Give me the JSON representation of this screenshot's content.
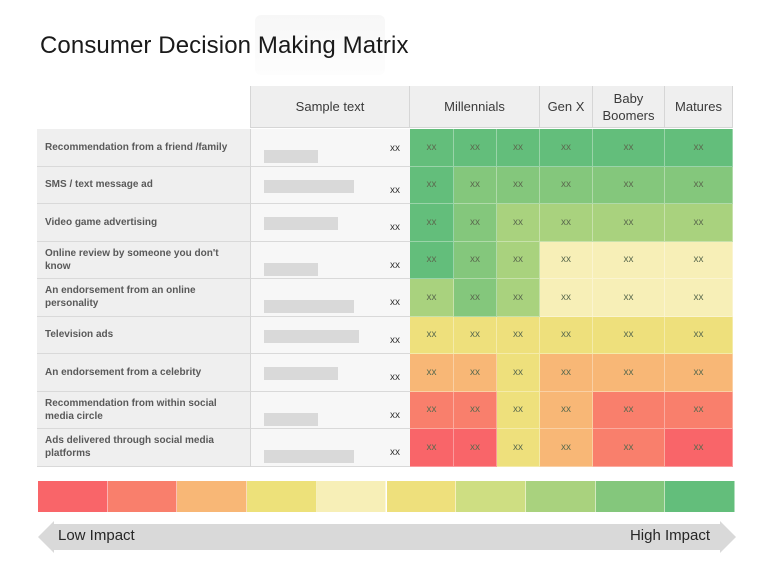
{
  "title": "Consumer Decision Making Matrix",
  "header": {
    "sample": "Sample text",
    "millennials": "Millennials",
    "genx": "Gen X",
    "baby_boomers": "Baby Boomers",
    "matures": "Matures"
  },
  "scale_colors": {
    "1": "#F96569",
    "2": "#F97F6C",
    "3": "#F8B776",
    "4": "#EDE17A",
    "5": "#F7EFB7",
    "6": "#EEE07C",
    "7": "#CEDE82",
    "8": "#A9D27E",
    "9": "#84C77C",
    "10": "#63BE7B"
  },
  "rows": [
    {
      "label": "Recommendation from a friend /family",
      "sample_value": "xx",
      "sample_fill": 0.6,
      "cell_text": "xx",
      "levels": [
        10,
        10,
        10,
        10,
        10,
        10
      ]
    },
    {
      "label": "SMS / text message ad",
      "sample_value": "xx",
      "sample_fill": 1.0,
      "cell_text": "xx",
      "levels": [
        10,
        9,
        9,
        9,
        9,
        9
      ]
    },
    {
      "label": "Video game advertising",
      "sample_value": "xx",
      "sample_fill": 0.82,
      "cell_text": "xx",
      "levels": [
        10,
        9,
        8,
        8,
        8,
        8
      ]
    },
    {
      "label": "Online review by someone you don't know",
      "sample_value": "xx",
      "sample_fill": 0.6,
      "cell_text": "xx",
      "levels": [
        10,
        9,
        8,
        5,
        5,
        5
      ]
    },
    {
      "label": "An endorsement from an online personality",
      "sample_value": "xx",
      "sample_fill": 1.0,
      "cell_text": "xx",
      "levels": [
        8,
        9,
        8,
        5,
        5,
        5
      ]
    },
    {
      "label": "Television ads",
      "sample_value": "xx",
      "sample_fill": 1.05,
      "cell_text": "xx",
      "levels": [
        6,
        6,
        6,
        6,
        6,
        6
      ]
    },
    {
      "label": "An endorsement from a celebrity",
      "sample_value": "xx",
      "sample_fill": 0.82,
      "cell_text": "xx",
      "levels": [
        3,
        3,
        6,
        3,
        3,
        3
      ]
    },
    {
      "label": "Recommendation from within social media circle",
      "sample_value": "xx",
      "sample_fill": 0.6,
      "cell_text": "xx",
      "levels": [
        2,
        2,
        6,
        3,
        2,
        2
      ]
    },
    {
      "label": "Ads delivered through social media platforms",
      "sample_value": "xx",
      "sample_fill": 1.0,
      "cell_text": "xx",
      "levels": [
        1,
        1,
        6,
        3,
        2,
        1
      ]
    }
  ],
  "legend": {
    "scale": [
      1,
      2,
      3,
      4,
      5,
      6,
      7,
      8,
      9,
      10
    ],
    "low_label": "Low Impact",
    "high_label": "High Impact"
  }
}
